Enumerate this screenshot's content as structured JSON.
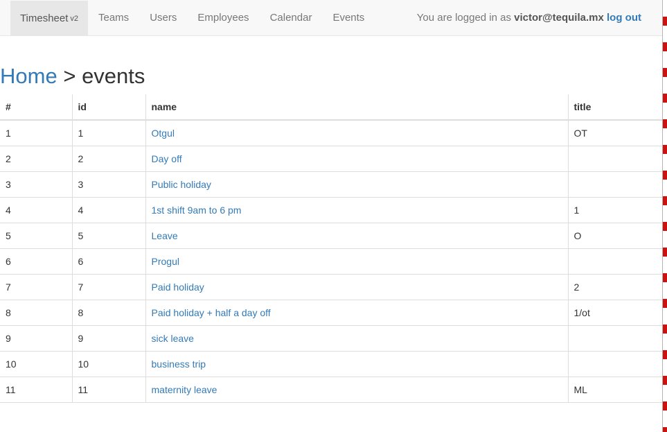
{
  "navbar": {
    "brand": "Timesheet",
    "brand_version": "v2",
    "links": [
      "Teams",
      "Users",
      "Employees",
      "Calendar",
      "Events"
    ],
    "login_prefix": "You are logged in as",
    "user_email": "victor@tequila.mx",
    "logout_label": "log out"
  },
  "breadcrumb": {
    "home": "Home",
    "separator": ">",
    "current": "events"
  },
  "table": {
    "headers": [
      "#",
      "id",
      "name",
      "title"
    ],
    "rows": [
      [
        "1",
        "1",
        "Otgul",
        "OT"
      ],
      [
        "2",
        "2",
        "Day off",
        ""
      ],
      [
        "3",
        "3",
        "Public holiday",
        ""
      ],
      [
        "4",
        "4",
        "1st shift 9am to 6 pm",
        "1"
      ],
      [
        "5",
        "5",
        "Leave",
        "O"
      ],
      [
        "6",
        "6",
        "Progul",
        ""
      ],
      [
        "7",
        "7",
        "Paid holiday",
        "2"
      ],
      [
        "8",
        "8",
        "Paid holiday + half a day off",
        "1/ot"
      ],
      [
        "9",
        "9",
        "sick leave",
        ""
      ],
      [
        "10",
        "10",
        "business trip",
        ""
      ],
      [
        "11",
        "11",
        "maternity leave",
        "ML"
      ]
    ]
  },
  "colors": {
    "link": "#337ab7",
    "navbar_bg": "#f8f8f8",
    "border": "#dddddd"
  }
}
